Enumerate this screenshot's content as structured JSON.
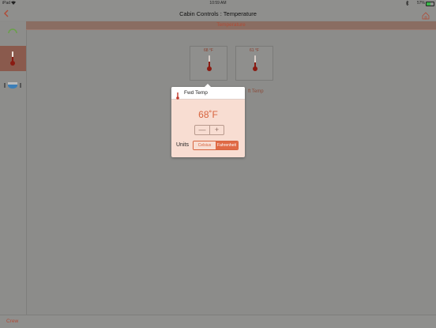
{
  "status_bar": {
    "device": "iPad",
    "time": "10:59 AM",
    "battery": "57%",
    "battery_level": 0.57
  },
  "nav": {
    "title": "Cabin Controls : Temperature"
  },
  "section": {
    "title": "Temperature"
  },
  "tiles": {
    "fwd": {
      "value": "68 °F"
    },
    "aft": {
      "value": "61 °F",
      "label": "ft Temp"
    }
  },
  "popover": {
    "title": "Fwd Temp",
    "value": "68˚F",
    "minus": "—",
    "plus": "+",
    "units_label": "Units",
    "units": {
      "celsius": "Celsius",
      "fahrenheit": "Fahrenheit",
      "selected": "fahrenheit"
    }
  },
  "bottom_bar": {
    "crew_label": "Crew"
  },
  "colors": {
    "accent": "#d7643f",
    "thermo_red": "#8a1b12",
    "selected_sidebar": "#8a5a4d"
  }
}
